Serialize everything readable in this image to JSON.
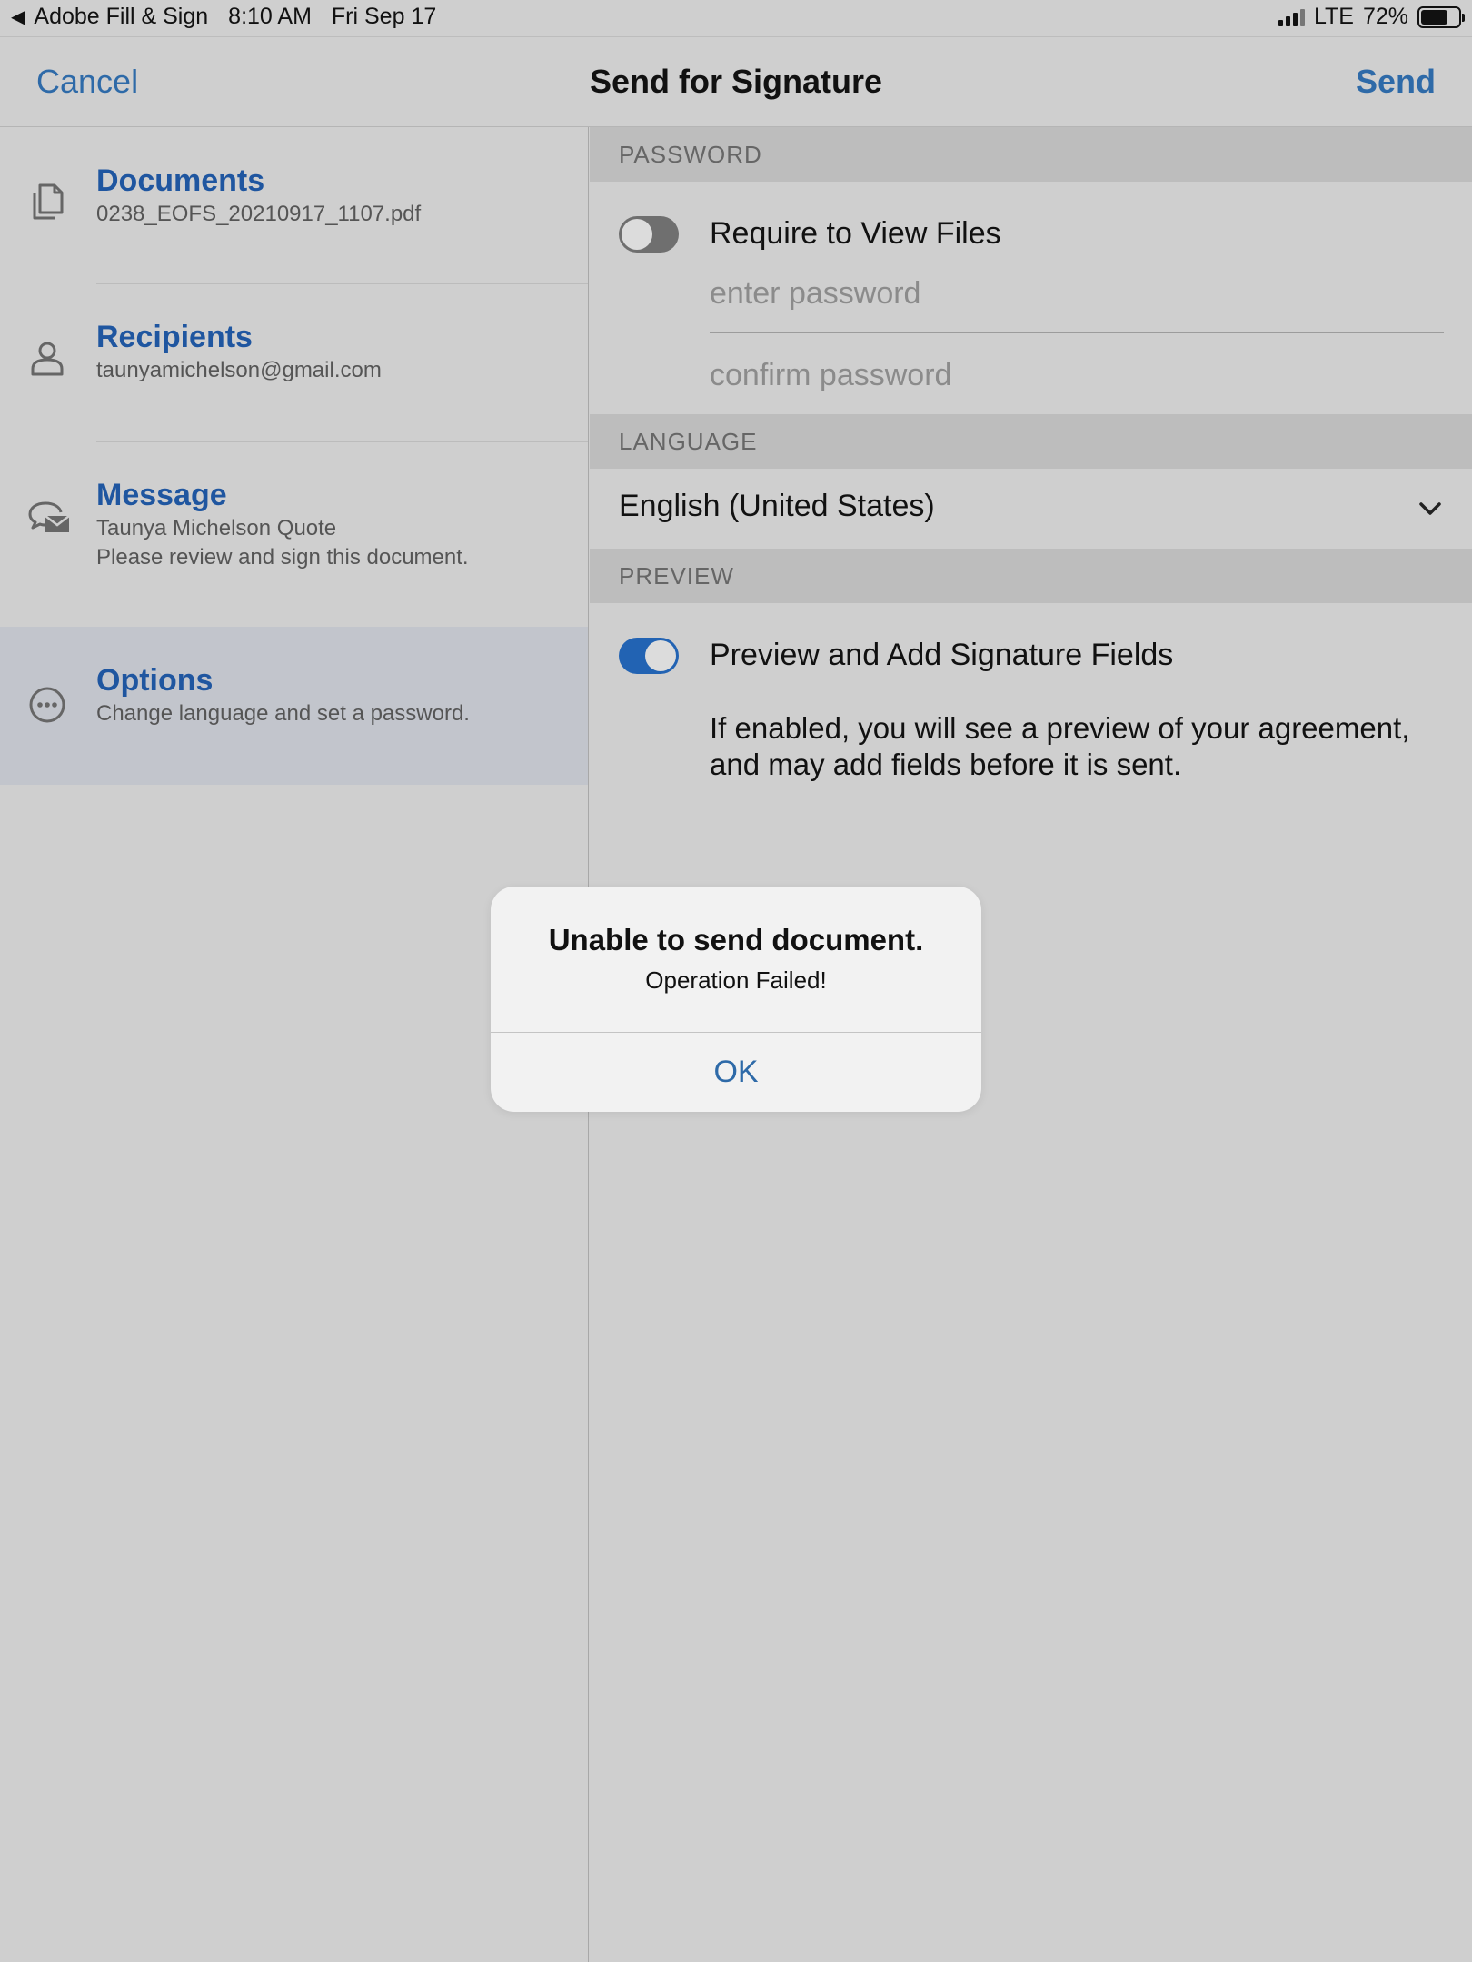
{
  "status_bar": {
    "back_app": "Adobe Fill & Sign",
    "time": "8:10 AM",
    "date": "Fri Sep 17",
    "network": "LTE",
    "battery": "72%",
    "battery_level": 0.72
  },
  "nav": {
    "cancel": "Cancel",
    "title": "Send for Signature",
    "send": "Send"
  },
  "sidebar": {
    "items": [
      {
        "title": "Documents",
        "subtitle": "0238_EOFS_20210917_1107.pdf",
        "icon": "document-icon"
      },
      {
        "title": "Recipients",
        "subtitle": "taunyamichelson@gmail.com",
        "icon": "person-icon"
      },
      {
        "title": "Message",
        "subtitle": "Taunya Michelson Quote",
        "subtitle2": "Please review and sign this document.",
        "icon": "message-envelope-icon"
      },
      {
        "title": "Options",
        "subtitle": "Change language and set a password.",
        "icon": "more-circle-icon",
        "selected": true
      }
    ]
  },
  "options": {
    "password": {
      "header": "PASSWORD",
      "toggle_label": "Require to View Files",
      "toggle_on": false,
      "enter_placeholder": "enter password",
      "confirm_placeholder": "confirm password"
    },
    "language": {
      "header": "LANGUAGE",
      "value": "English (United States)"
    },
    "preview": {
      "header": "PREVIEW",
      "toggle_label": "Preview and Add Signature Fields",
      "toggle_on": true,
      "description": "If enabled, you will see a preview of your agreement, and may add fields before it is sent."
    }
  },
  "alert": {
    "title": "Unable to send document.",
    "message": "Operation Failed!",
    "ok": "OK"
  },
  "colors": {
    "accent": "#2e6aa8",
    "sidebar_title": "#1f56a0",
    "toggle_on": "#2263b3",
    "background": "#cfcfcf"
  }
}
